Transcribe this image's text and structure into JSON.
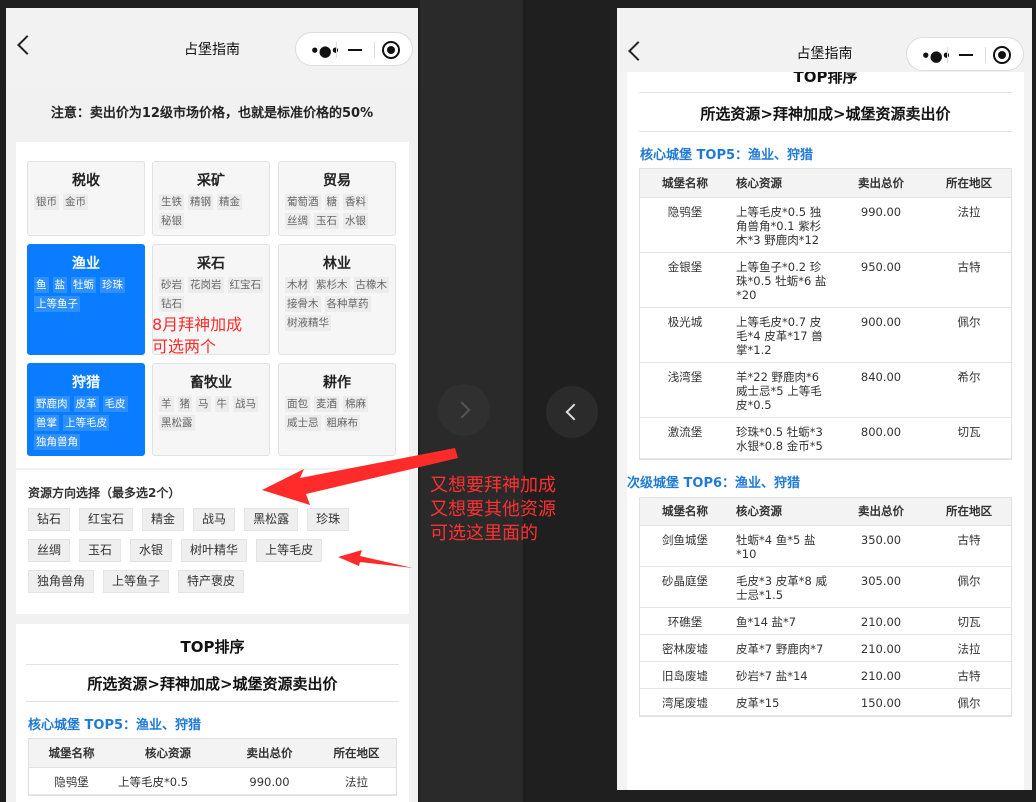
{
  "nav": {
    "title": "占堡指南"
  },
  "notice": "注意：卖出价为12级市场价格，也就是标准价格的50%",
  "categories": [
    {
      "name": "税收",
      "items": [
        "银币",
        "金币"
      ],
      "selected": false
    },
    {
      "name": "采矿",
      "items": [
        "生铁",
        "精钢",
        "精金",
        "秘银"
      ],
      "selected": false
    },
    {
      "name": "贸易",
      "items": [
        "葡萄酒",
        "糖",
        "香料",
        "丝绸",
        "玉石",
        "水银"
      ],
      "selected": false
    },
    {
      "name": "渔业",
      "items": [
        "鱼",
        "盐",
        "牡蛎",
        "珍珠",
        "上等鱼子"
      ],
      "selected": true
    },
    {
      "name": "采石",
      "items": [
        "砂岩",
        "花岗岩",
        "红宝石",
        "钻石"
      ],
      "selected": false
    },
    {
      "name": "林业",
      "items": [
        "木材",
        "紫杉木",
        "古橡木",
        "接骨木",
        "各种草药",
        "树液精华"
      ],
      "selected": false
    },
    {
      "name": "狩猎",
      "items": [
        "野鹿肉",
        "皮革",
        "毛皮",
        "兽掌",
        "上等毛皮",
        "独角兽角"
      ],
      "selected": true
    },
    {
      "name": "畜牧业",
      "items": [
        "羊",
        "猪",
        "马",
        "牛",
        "战马",
        "黑松露"
      ],
      "selected": false
    },
    {
      "name": "耕作",
      "items": [
        "面包",
        "麦酒",
        "棉麻",
        "威士忌",
        "粗麻布"
      ],
      "selected": false
    }
  ],
  "resource": {
    "title": "资源方向选择（最多选2个）",
    "options": [
      "钻石",
      "红宝石",
      "精金",
      "战马",
      "黑松露",
      "珍珠",
      "丝绸",
      "玉石",
      "水银",
      "树叶精华",
      "上等毛皮",
      "独角兽角",
      "上等鱼子",
      "特产褒皮"
    ]
  },
  "ranking": {
    "top_title": "TOP排序",
    "subtitle": "所选资源>拜神加成>城堡资源卖出价",
    "headers": [
      "城堡名称",
      "核心资源",
      "卖出总价",
      "所在地区"
    ],
    "core_title": "核心城堡 TOP5：渔业、狩猎",
    "core_rows": [
      {
        "name": "隐鸮堡",
        "res": "上等毛皮*0.5 独角兽角*0.1 紫杉木*3 野鹿肉*12",
        "price": "990.00",
        "region": "法拉"
      },
      {
        "name": "金银堡",
        "res": "上等鱼子*0.2 珍珠*0.5 牡蛎*6 盐*20",
        "price": "950.00",
        "region": "古特"
      },
      {
        "name": "极光城",
        "res": "上等毛皮*0.7 皮毛*4 皮革*17 兽掌*1.2",
        "price": "900.00",
        "region": "佩尔"
      },
      {
        "name": "浅湾堡",
        "res": "羊*22 野鹿肉*6 威士忌*5 上等毛皮*0.5",
        "price": "840.00",
        "region": "希尔"
      },
      {
        "name": "激流堡",
        "res": "珍珠*0.5 牡蛎*3 水银*0.8 金币*5",
        "price": "800.00",
        "region": "切瓦"
      }
    ],
    "second_title": "次级城堡 TOP6：渔业、狩猎",
    "second_rows": [
      {
        "name": "剑鱼城堡",
        "res": "牡蛎*4 鱼*5 盐*10",
        "price": "350.00",
        "region": "古特"
      },
      {
        "name": "砂晶庭堡",
        "res": "毛皮*3 皮革*8 威士忌*1.5",
        "price": "305.00",
        "region": "佩尔"
      },
      {
        "name": "环礁堡",
        "res": "鱼*14 盐*7",
        "price": "210.00",
        "region": "切瓦"
      },
      {
        "name": "密林废墟",
        "res": "皮革*7 野鹿肉*7",
        "price": "210.00",
        "region": "法拉"
      },
      {
        "name": "旧岛废墟",
        "res": "砂岩*7 盐*14",
        "price": "210.00",
        "region": "古特"
      },
      {
        "name": "湾尾废墟",
        "res": "皮革*15",
        "price": "150.00",
        "region": "佩尔"
      }
    ],
    "partial_row": {
      "name": "隐鸮堡",
      "res": "上等毛皮*0.5",
      "price": "990.00",
      "region": "法拉"
    }
  },
  "annotations": {
    "note1_line1": "8月拜神加成",
    "note1_line2": "可选两个",
    "note2_line1": "又想要拜神加成",
    "note2_line2": "又想要其他资源",
    "note2_line3": "可选这里面的"
  },
  "colors": {
    "accent": "#0a7cff",
    "section": "#1f7ad6",
    "annotation": "#ff2b2b"
  },
  "icons": [
    "back-arrow-icon",
    "more-dots-icon",
    "minimize-icon",
    "record-icon",
    "chevron-right-icon",
    "chevron-left-icon"
  ]
}
